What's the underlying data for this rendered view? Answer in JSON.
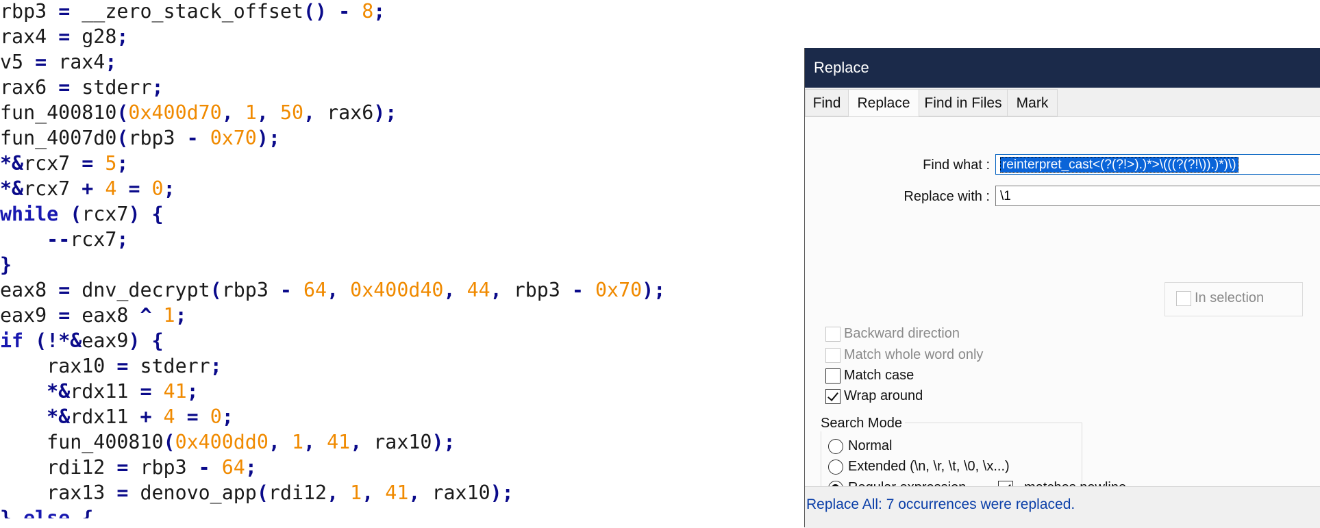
{
  "editor": {
    "lines": [
      [
        [
          "id",
          "rbp3 "
        ],
        [
          "op",
          "="
        ],
        [
          "id",
          " __zero_stack_offset"
        ],
        [
          "op",
          "()"
        ],
        [
          "id",
          " "
        ],
        [
          "op",
          "-"
        ],
        [
          "id",
          " "
        ],
        [
          "num",
          "8"
        ],
        [
          "op",
          ";"
        ]
      ],
      [
        [
          "id",
          "rax4 "
        ],
        [
          "op",
          "="
        ],
        [
          "id",
          " g28"
        ],
        [
          "op",
          ";"
        ]
      ],
      [
        [
          "id",
          "v5 "
        ],
        [
          "op",
          "="
        ],
        [
          "id",
          " rax4"
        ],
        [
          "op",
          ";"
        ]
      ],
      [
        [
          "id",
          "rax6 "
        ],
        [
          "op",
          "="
        ],
        [
          "id",
          " stderr"
        ],
        [
          "op",
          ";"
        ]
      ],
      [
        [
          "id",
          "fun_400810"
        ],
        [
          "op",
          "("
        ],
        [
          "num",
          "0x400d70"
        ],
        [
          "op",
          ","
        ],
        [
          "id",
          " "
        ],
        [
          "num",
          "1"
        ],
        [
          "op",
          ","
        ],
        [
          "id",
          " "
        ],
        [
          "num",
          "50"
        ],
        [
          "op",
          ","
        ],
        [
          "id",
          " rax6"
        ],
        [
          "op",
          ");"
        ]
      ],
      [
        [
          "id",
          "fun_4007d0"
        ],
        [
          "op",
          "("
        ],
        [
          "id",
          "rbp3 "
        ],
        [
          "op",
          "-"
        ],
        [
          "id",
          " "
        ],
        [
          "num",
          "0x70"
        ],
        [
          "op",
          ");"
        ]
      ],
      [
        [
          "op",
          "*&"
        ],
        [
          "id",
          "rcx7 "
        ],
        [
          "op",
          "="
        ],
        [
          "id",
          " "
        ],
        [
          "num",
          "5"
        ],
        [
          "op",
          ";"
        ]
      ],
      [
        [
          "op",
          "*&"
        ],
        [
          "id",
          "rcx7 "
        ],
        [
          "op",
          "+"
        ],
        [
          "id",
          " "
        ],
        [
          "num",
          "4"
        ],
        [
          "id",
          " "
        ],
        [
          "op",
          "="
        ],
        [
          "id",
          " "
        ],
        [
          "num",
          "0"
        ],
        [
          "op",
          ";"
        ]
      ],
      [
        [
          "kw",
          "while"
        ],
        [
          "id",
          " "
        ],
        [
          "op",
          "("
        ],
        [
          "id",
          "rcx7"
        ],
        [
          "op",
          ")"
        ],
        [
          "id",
          " "
        ],
        [
          "op",
          "{"
        ]
      ],
      [
        [
          "ws",
          "    "
        ],
        [
          "op",
          "--"
        ],
        [
          "id",
          "rcx7"
        ],
        [
          "op",
          ";"
        ]
      ],
      [
        [
          "op",
          "}"
        ]
      ],
      [
        [
          "id",
          "eax8 "
        ],
        [
          "op",
          "="
        ],
        [
          "id",
          " dnv_decrypt"
        ],
        [
          "op",
          "("
        ],
        [
          "id",
          "rbp3 "
        ],
        [
          "op",
          "-"
        ],
        [
          "id",
          " "
        ],
        [
          "num",
          "64"
        ],
        [
          "op",
          ","
        ],
        [
          "id",
          " "
        ],
        [
          "num",
          "0x400d40"
        ],
        [
          "op",
          ","
        ],
        [
          "id",
          " "
        ],
        [
          "num",
          "44"
        ],
        [
          "op",
          ","
        ],
        [
          "id",
          " rbp3 "
        ],
        [
          "op",
          "-"
        ],
        [
          "id",
          " "
        ],
        [
          "num",
          "0x70"
        ],
        [
          "op",
          ");"
        ]
      ],
      [
        [
          "id",
          "eax9 "
        ],
        [
          "op",
          "="
        ],
        [
          "id",
          " eax8 "
        ],
        [
          "op",
          "^"
        ],
        [
          "id",
          " "
        ],
        [
          "num",
          "1"
        ],
        [
          "op",
          ";"
        ]
      ],
      [
        [
          "kw",
          "if"
        ],
        [
          "id",
          " "
        ],
        [
          "op",
          "(!*&"
        ],
        [
          "id",
          "eax9"
        ],
        [
          "op",
          ")"
        ],
        [
          "id",
          " "
        ],
        [
          "op",
          "{"
        ]
      ],
      [
        [
          "ws",
          "    "
        ],
        [
          "id",
          "rax10 "
        ],
        [
          "op",
          "="
        ],
        [
          "id",
          " stderr"
        ],
        [
          "op",
          ";"
        ]
      ],
      [
        [
          "ws",
          "    "
        ],
        [
          "op",
          "*&"
        ],
        [
          "id",
          "rdx11 "
        ],
        [
          "op",
          "="
        ],
        [
          "id",
          " "
        ],
        [
          "num",
          "41"
        ],
        [
          "op",
          ";"
        ]
      ],
      [
        [
          "ws",
          "    "
        ],
        [
          "op",
          "*&"
        ],
        [
          "id",
          "rdx11 "
        ],
        [
          "op",
          "+"
        ],
        [
          "id",
          " "
        ],
        [
          "num",
          "4"
        ],
        [
          "id",
          " "
        ],
        [
          "op",
          "="
        ],
        [
          "id",
          " "
        ],
        [
          "num",
          "0"
        ],
        [
          "op",
          ";"
        ]
      ],
      [
        [
          "ws",
          "    "
        ],
        [
          "id",
          "fun_400810"
        ],
        [
          "op",
          "("
        ],
        [
          "num",
          "0x400dd0"
        ],
        [
          "op",
          ","
        ],
        [
          "id",
          " "
        ],
        [
          "num",
          "1"
        ],
        [
          "op",
          ","
        ],
        [
          "id",
          " "
        ],
        [
          "num",
          "41"
        ],
        [
          "op",
          ","
        ],
        [
          "id",
          " rax10"
        ],
        [
          "op",
          ");"
        ]
      ],
      [
        [
          "ws",
          "    "
        ],
        [
          "id",
          "rdi12 "
        ],
        [
          "op",
          "="
        ],
        [
          "id",
          " rbp3 "
        ],
        [
          "op",
          "-"
        ],
        [
          "id",
          " "
        ],
        [
          "num",
          "64"
        ],
        [
          "op",
          ";"
        ]
      ],
      [
        [
          "ws",
          "    "
        ],
        [
          "id",
          "rax13 "
        ],
        [
          "op",
          "="
        ],
        [
          "id",
          " denovo_app"
        ],
        [
          "op",
          "("
        ],
        [
          "id",
          "rdi12"
        ],
        [
          "op",
          ","
        ],
        [
          "id",
          " "
        ],
        [
          "num",
          "1"
        ],
        [
          "op",
          ","
        ],
        [
          "id",
          " "
        ],
        [
          "num",
          "41"
        ],
        [
          "op",
          ","
        ],
        [
          "id",
          " rax10"
        ],
        [
          "op",
          ");"
        ]
      ],
      [
        [
          "op",
          "}"
        ],
        [
          "id",
          " "
        ],
        [
          "kw",
          "else"
        ],
        [
          "id",
          " "
        ],
        [
          "op",
          "{"
        ]
      ]
    ]
  },
  "dialog": {
    "title": "Replace",
    "tabs": [
      {
        "label": "Find",
        "active": false
      },
      {
        "label": "Replace",
        "active": true
      },
      {
        "label": "Find in Files",
        "active": false
      },
      {
        "label": "Mark",
        "active": false
      }
    ],
    "find_label": "Find what :",
    "find_value": "reinterpret_cast<(?(?!>).)*>\\(((?(?!\\)).)*)\\)",
    "replace_label": "Replace with :",
    "replace_value": "\\1",
    "in_selection_label": "In selection",
    "options": {
      "backward_direction": "Backward direction",
      "match_whole_word": "Match whole word only",
      "match_case": "Match case",
      "wrap_around": "Wrap around"
    },
    "search_mode": {
      "legend": "Search Mode",
      "normal": "Normal",
      "extended": "Extended (\\n, \\r, \\t, \\0, \\x...)",
      "regex": "Regular expression",
      "dot_newline": ". matches newline"
    },
    "status": "Replace All: 7 occurrences were replaced."
  },
  "colors": {
    "keyword": "#1818b0",
    "number": "#f08a00",
    "operator": "#0a0a8a",
    "titlebar": "#1b2a4a",
    "status_text": "#0b3fa8",
    "selection": "#0a64d8"
  }
}
